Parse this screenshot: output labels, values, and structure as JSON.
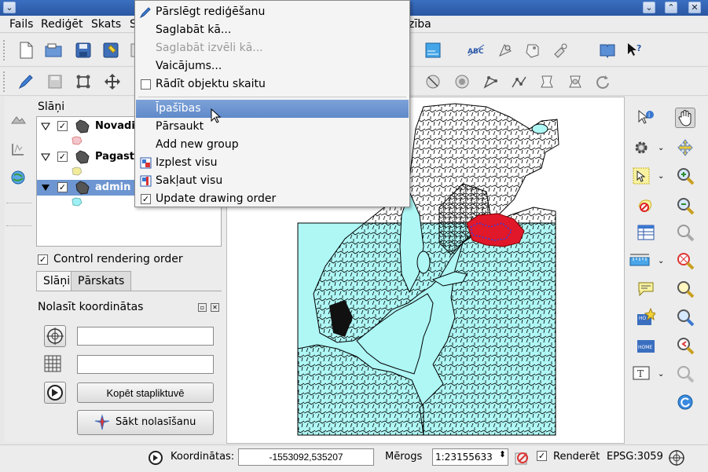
{
  "menubar": {
    "items": [
      {
        "label": "Fails",
        "u": "F"
      },
      {
        "label": "Rediģēt",
        "u": "R"
      },
      {
        "label": "Skats",
        "u": "S"
      },
      {
        "label": "S",
        "u": ""
      },
      {
        "label": "zība",
        "u": ""
      }
    ]
  },
  "context_menu": {
    "items": [
      {
        "label": "Pārslēgt rediģēšanu",
        "icon": "pencil-icon",
        "state": "normal"
      },
      {
        "label": "Saglabāt kā...",
        "icon": "",
        "state": "normal"
      },
      {
        "label": "Saglabāt izvēli kā...",
        "icon": "",
        "state": "disabled"
      },
      {
        "label": "Vaicājums...",
        "icon": "",
        "state": "normal"
      },
      {
        "label": "Rādīt objektu skaitu",
        "icon": "checkbox-unchecked-icon",
        "state": "normal"
      },
      {
        "label": "Īpašības",
        "icon": "",
        "state": "highlight"
      },
      {
        "label": "Pārsaukt",
        "icon": "",
        "state": "normal"
      },
      {
        "label": "Add new group",
        "icon": "",
        "state": "normal"
      },
      {
        "label": "Izplest visu",
        "icon": "expand-all-icon",
        "state": "normal"
      },
      {
        "label": "Sakļaut visu",
        "icon": "collapse-all-icon",
        "state": "normal"
      },
      {
        "label": "Update drawing order",
        "icon": "checkbox-checked-icon",
        "state": "normal"
      }
    ]
  },
  "layers_panel": {
    "title": "Slāņi",
    "layers": [
      {
        "name": "Novadi_",
        "checked": true,
        "symbol_color": "#f4c6cc"
      },
      {
        "name": "Pagasti",
        "checked": true,
        "symbol_color": "#f2eb9a"
      },
      {
        "name": "admin",
        "checked": true,
        "symbol_color": "#9ff0f4",
        "selected": true
      }
    ],
    "control_rendering_order_label": "Control rendering order",
    "control_rendering_order_checked": true,
    "tabs": [
      "Slāņi",
      "Pārskats"
    ]
  },
  "coordinate_capture": {
    "title": "Nolasīt koordinātas",
    "field1_value": "",
    "field2_value": "",
    "copy_button_label": "Kopēt stapliktuvē",
    "start_button_label": "Sākt nolasīšanu"
  },
  "statusbar": {
    "coordinates_label": "Koordinātas:",
    "coordinates_value": "-1553092,535207",
    "scale_label": "Mērogs",
    "scale_value": "1:23155633",
    "render_label": "Renderēt",
    "render_checked": true,
    "crs_label": "EPSG:3059"
  },
  "colors": {
    "titlebar": "#2f62b2",
    "map_sea": "#aef7f5",
    "map_highlight": "#e0182a",
    "menu_highlight": "#6a92cf"
  }
}
